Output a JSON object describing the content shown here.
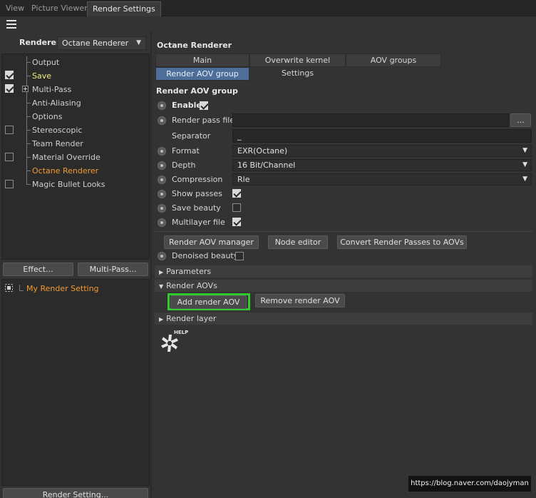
{
  "tabs": [
    "View",
    "Picture Viewer",
    "Render Settings"
  ],
  "active_tab": "Render Settings",
  "left": {
    "renderer_label": "Renderer",
    "renderer_value": "Octane Renderer",
    "tree": [
      {
        "label": "Output",
        "checkbox": null
      },
      {
        "label": "Save",
        "checkbox": true
      },
      {
        "label": "Multi-Pass",
        "checkbox": true
      },
      {
        "label": "Anti-Aliasing",
        "checkbox": null
      },
      {
        "label": "Options",
        "checkbox": null
      },
      {
        "label": "Stereoscopic",
        "checkbox": false
      },
      {
        "label": "Team Render",
        "checkbox": null
      },
      {
        "label": "Material Override",
        "checkbox": false
      },
      {
        "label": "Octane Renderer",
        "checkbox": null
      },
      {
        "label": "Magic Bullet Looks",
        "checkbox": false
      }
    ],
    "effect_button": "Effect...",
    "multipass_button": "Multi-Pass...",
    "setting_name": "My Render Setting",
    "render_setting_button": "Render Setting..."
  },
  "right": {
    "title": "Octane Renderer",
    "subtabs": [
      "Main",
      "Overwrite kernel Settings",
      "AOV groups",
      "Render AOV group"
    ],
    "active_subtab": "Render AOV group",
    "group_title": "Render AOV group",
    "enable_label": "Enable",
    "render_pass_file_label": "Render pass file",
    "render_pass_file_value": "",
    "browse_button": "...",
    "separator_label": "Separator",
    "separator_value": "_",
    "format_label": "Format",
    "format_value": "EXR(Octane)",
    "depth_label": "Depth",
    "depth_value": "16 Bit/Channel",
    "compression_label": "Compression",
    "compression_value": "Rle",
    "show_passes_label": "Show passes",
    "save_beauty_label": "Save beauty",
    "multilayer_label": "Multilayer file",
    "buttons": {
      "render_aov_manager": "Render AOV manager",
      "node_editor": "Node editor",
      "convert": "Convert Render Passes to AOVs"
    },
    "denoised_beauty_label": "Denoised beauty",
    "sections": {
      "parameters": "Parameters",
      "render_aovs": "Render AOVs",
      "render_layer": "Render layer"
    },
    "add_render_aov": "Add render AOV",
    "remove_render_aov": "Remove render AOV",
    "help_label": "HELP"
  },
  "watermark": "https://blog.naver.com/daojyman"
}
